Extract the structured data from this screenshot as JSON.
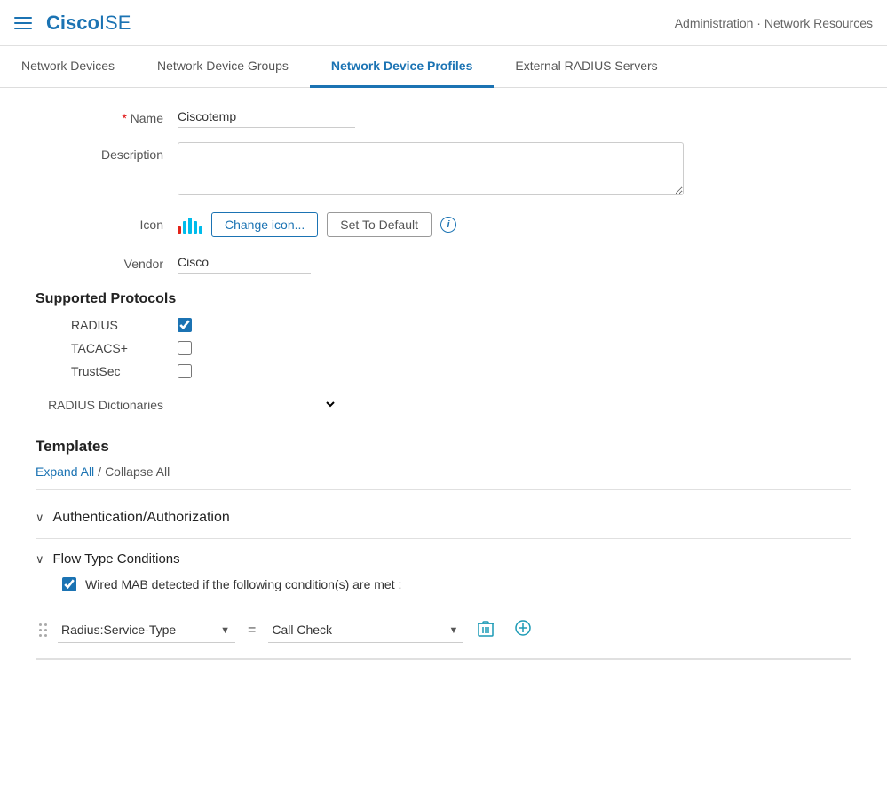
{
  "header": {
    "hamburger_label": "Menu",
    "logo_cisco": "Cisco",
    "logo_ise": " ISE",
    "breadcrumb": "Administration · Network Resources"
  },
  "tabs": [
    {
      "id": "network-devices",
      "label": "Network Devices",
      "active": false
    },
    {
      "id": "network-device-groups",
      "label": "Network Device Groups",
      "active": false
    },
    {
      "id": "network-device-profiles",
      "label": "Network Device Profiles",
      "active": true
    },
    {
      "id": "external-radius-servers",
      "label": "External RADIUS Servers",
      "active": false
    }
  ],
  "form": {
    "name_label": "* Name",
    "name_value": "Ciscotemp",
    "description_label": "Description",
    "description_placeholder": "",
    "icon_label": "Icon",
    "change_icon_btn": "Change icon...",
    "set_to_default_btn": "Set To Default",
    "vendor_label": "Vendor",
    "vendor_value": "Cisco"
  },
  "supported_protocols": {
    "title": "Supported Protocols",
    "radius_label": "RADIUS",
    "radius_checked": true,
    "tacacs_label": "TACACS+",
    "tacacs_checked": false,
    "trustsec_label": "TrustSec",
    "trustsec_checked": false,
    "dictionaries_label": "RADIUS Dictionaries"
  },
  "templates": {
    "title": "Templates",
    "expand_all": "Expand All",
    "separator": "/",
    "collapse_all": "Collapse All"
  },
  "accordion": [
    {
      "id": "auth-authz",
      "label": "Authentication/Authorization",
      "expanded": false
    }
  ],
  "flow_conditions": {
    "title": "Flow Type Conditions",
    "expanded": true,
    "condition_text": "Wired MAB detected if the following condition(s) are met :",
    "condition_checked": true,
    "attribute_label": "Radius:Service-Type",
    "equals": "=",
    "value_label": "Call Check",
    "attribute_options": [
      "Radius:Service-Type"
    ],
    "value_options": [
      "Call Check"
    ]
  },
  "icons": {
    "chevron_down": "∨",
    "plus": "+",
    "info": "i"
  }
}
